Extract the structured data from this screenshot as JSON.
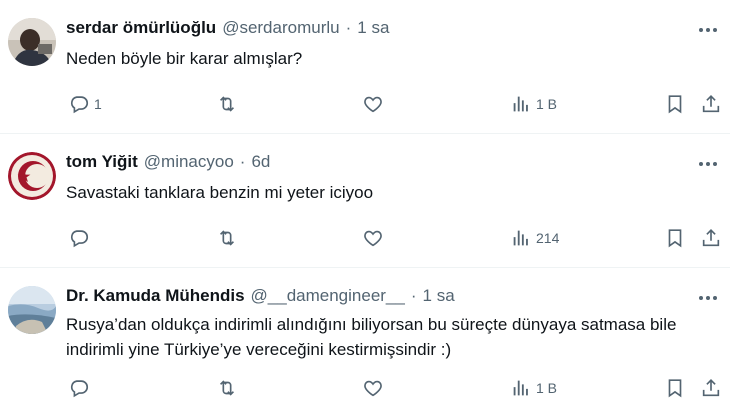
{
  "tweets": [
    {
      "name": "serdar ömürlüoğlu",
      "handle": "@serdaromurlu",
      "separator": "·",
      "time": "1 sa",
      "text": "Neden böyle bir karar almışlar?",
      "replies": "1",
      "views": "1 B",
      "avatar_icon": "person-photo-avatar"
    },
    {
      "name": "tom Yiğit",
      "handle": "@minacyoo",
      "separator": "·",
      "time": "6d",
      "text": "Savastaki tanklara benzin mi yeter iciyoo",
      "replies": "",
      "views": "214",
      "avatar_icon": "crescent-star-avatar"
    },
    {
      "name": "Dr. Kamuda Mühendis",
      "handle": "@__damengineer__",
      "separator": "·",
      "time": "1 sa",
      "text": "Rusya’dan oldukça indirimli alındığını biliyorsan bu süreçte dünyaya satmasa bile indirimli yine Türkiye’ye vereceğini kestirmişsindir :)",
      "replies": "",
      "views": "1 B",
      "avatar_icon": "landscape-photo-avatar"
    }
  ],
  "colors": {
    "text": "#0f1419",
    "secondary": "#536471",
    "divider": "#eff3f4",
    "avatar2_red": "#a3162b"
  },
  "icons": [
    "reply-icon",
    "retweet-icon",
    "like-icon",
    "views-icon",
    "bookmark-icon",
    "share-icon",
    "more-icon"
  ]
}
